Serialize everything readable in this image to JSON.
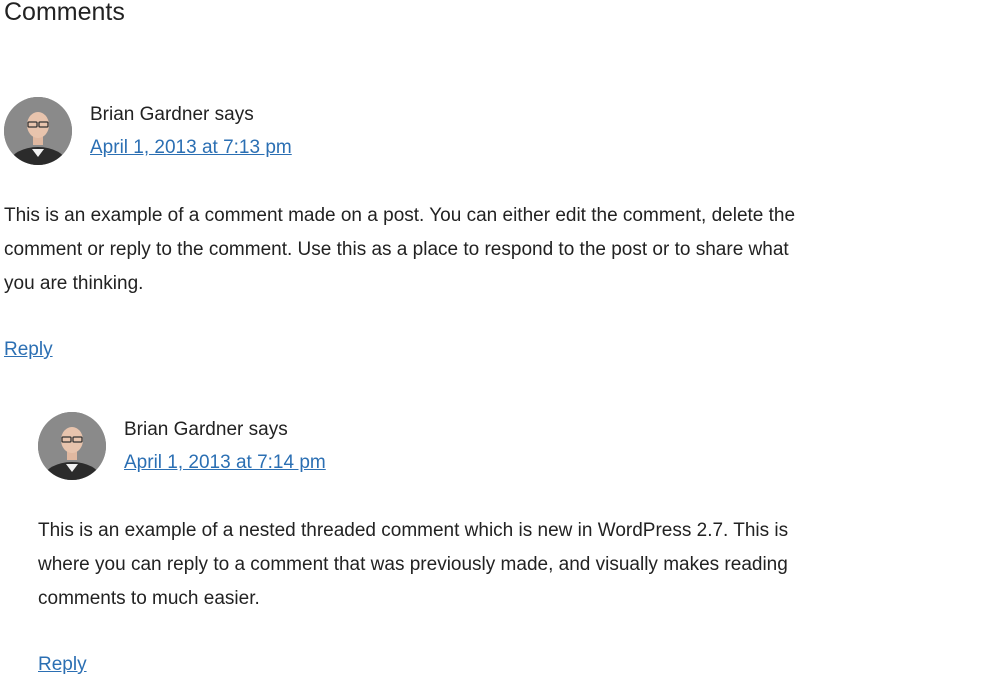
{
  "page": {
    "heading": "Comments"
  },
  "comments": [
    {
      "author": "Brian Gardner",
      "says": "says",
      "date": "April 1, 2013 at 7:13 pm",
      "text": "This is an example of a comment made on a post. You can either edit the comment, delete the comment or reply to the comment. Use this as a place to respond to the post or to share what you are thinking.",
      "reply_label": "Reply"
    },
    {
      "author": "Brian Gardner",
      "says": "says",
      "date": "April 1, 2013 at 7:14 pm",
      "text": "This is an example of a nested threaded comment which is new in WordPress 2.7. This is where you can reply to a comment that was previously made, and visually makes reading comments to much easier.",
      "reply_label": "Reply"
    }
  ],
  "colors": {
    "link": "#2b6fb3",
    "text": "#222222"
  }
}
